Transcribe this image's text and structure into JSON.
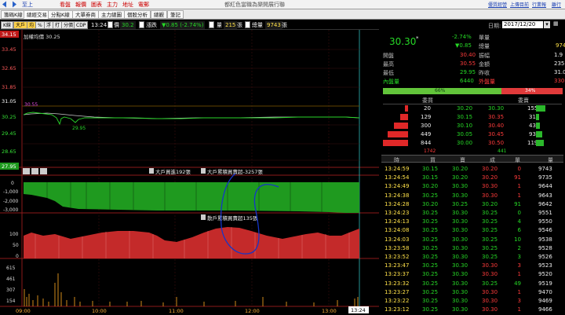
{
  "topbar": {
    "nav_back": "至上",
    "toolbar": [
      "看盤",
      "報價",
      "圖表",
      "主力",
      "地址",
      "電郵"
    ],
    "title": "都紅色當職為樂開展行聯",
    "links": [
      "優質經營",
      "上傳目前",
      "行業報",
      "離行"
    ]
  },
  "tabs": [
    "籌碼K線",
    "總經交易",
    "分點K線",
    "大單券商",
    "主力總圖",
    "個股分析",
    "總觀",
    "筆記"
  ],
  "chart_header": {
    "mode_buttons": [
      "K線",
      "大戶",
      "均",
      "%",
      "浮",
      "打",
      "分價",
      "CDP"
    ],
    "time": "13:24",
    "price_label": "價",
    "price": "30.2",
    "change_label": "漲跌",
    "change": "▼0.85 (-2.74%)",
    "volume_label": "量",
    "volume": "215",
    "volume_unit": "張",
    "total_label": "總量",
    "total": "9743",
    "total_unit": "張"
  },
  "price_panel": {
    "title": "加權均價 30.25",
    "top_value": "34.15",
    "bottom_value": "27.95",
    "axis": [
      "33.45",
      "32.65",
      "31.85",
      "31.05",
      "30.25",
      "29.45",
      "28.65"
    ],
    "annot_high": "30.55",
    "annot_low": "29.95"
  },
  "big_player_panel": {
    "label1": "大戶買進192張",
    "label2": "大戶累積買賣超-3257張",
    "axis": [
      "0",
      "-1,000",
      "-2,000",
      "-3,000"
    ]
  },
  "retail_panel": {
    "label": "散戶累積買賣超135張",
    "axis": [
      "100",
      "50",
      "0"
    ]
  },
  "volume_panel": {
    "axis": [
      "615",
      "461",
      "307",
      "154"
    ]
  },
  "time_axis": [
    "09:00",
    "10:00",
    "11:00",
    "12:00",
    "13:00"
  ],
  "time_marker": "13:24",
  "quote": {
    "date_label": "日期:",
    "date": "2017/12/20",
    "price": "30.30",
    "star": "*",
    "change_pct": "-2.74%",
    "change_amt": "▼0.85",
    "unit_label": "單量",
    "total_label": "總量",
    "total_value": "974",
    "rows": [
      {
        "l1": "開盤",
        "v1": "30.40",
        "l2": "振幅",
        "v2": "1.9"
      },
      {
        "l1": "最高",
        "v1": "30.55",
        "l2": "金額",
        "v2": "235"
      },
      {
        "l1": "最低",
        "v1": "29.95",
        "l2": "昨收",
        "v2": "31.0"
      },
      {
        "l1": "內盤量",
        "v1": "6440",
        "l2": "外盤量",
        "v2": "330"
      }
    ],
    "ratio_in": "66%",
    "ratio_out": "34%",
    "bid_header": "委買",
    "ask_header": "委賣",
    "book": [
      {
        "bid_vol": "20",
        "bid": "30.20",
        "ask": "30.30",
        "ask_vol": "155"
      },
      {
        "bid_vol": "129",
        "bid": "30.15",
        "ask": "30.35",
        "ask_vol": "31"
      },
      {
        "bid_vol": "300",
        "bid": "30.10",
        "ask": "30.40",
        "ask_vol": "43"
      },
      {
        "bid_vol": "449",
        "bid": "30.05",
        "ask": "30.45",
        "ask_vol": "93"
      },
      {
        "bid_vol": "844",
        "bid": "30.00",
        "ask": "30.50",
        "ask_vol": "119"
      }
    ],
    "bid_total": "1742",
    "ask_total": "441"
  },
  "ticks": {
    "headers": [
      "時",
      "買",
      "賣",
      "成",
      "單",
      "量"
    ],
    "rows": [
      [
        "13:24:59",
        "30.15",
        "30.20",
        "30.20",
        "0",
        "9743"
      ],
      [
        "13:24:54",
        "30.15",
        "30.20",
        "30.20",
        "91",
        "9735"
      ],
      [
        "13:24:49",
        "30.20",
        "30.30",
        "30.30",
        "1",
        "9644"
      ],
      [
        "13:24:38",
        "30.25",
        "30.30",
        "30.30",
        "1",
        "9643"
      ],
      [
        "13:24:28",
        "30.20",
        "30.25",
        "30.20",
        "91",
        "9642"
      ],
      [
        "13:24:23",
        "30.25",
        "30.30",
        "30.25",
        "0",
        "9551"
      ],
      [
        "13:24:13",
        "30.25",
        "30.30",
        "30.25",
        "4",
        "9550"
      ],
      [
        "13:24:08",
        "30.25",
        "30.30",
        "30.25",
        "6",
        "9546"
      ],
      [
        "13:24:03",
        "30.25",
        "30.30",
        "30.25",
        "10",
        "9538"
      ],
      [
        "13:23:58",
        "30.25",
        "30.30",
        "30.25",
        "2",
        "9528"
      ],
      [
        "13:23:52",
        "30.25",
        "30.30",
        "30.25",
        "3",
        "9526"
      ],
      [
        "13:23:47",
        "30.25",
        "30.30",
        "30.30",
        "3",
        "9523"
      ],
      [
        "13:23:37",
        "30.25",
        "30.30",
        "30.30",
        "1",
        "9520"
      ],
      [
        "13:23:32",
        "30.25",
        "30.30",
        "30.25",
        "49",
        "9519"
      ],
      [
        "13:23:27",
        "30.25",
        "30.30",
        "30.30",
        "1",
        "9470"
      ],
      [
        "13:23:22",
        "30.25",
        "30.30",
        "30.30",
        "3",
        "9469"
      ],
      [
        "13:23:12",
        "30.25",
        "30.30",
        "30.30",
        "1",
        "9466"
      ]
    ]
  },
  "colors": {
    "up": "#ff3b3b",
    "down": "#26d926",
    "accent": "#ffe24a",
    "bg": "#000000"
  }
}
